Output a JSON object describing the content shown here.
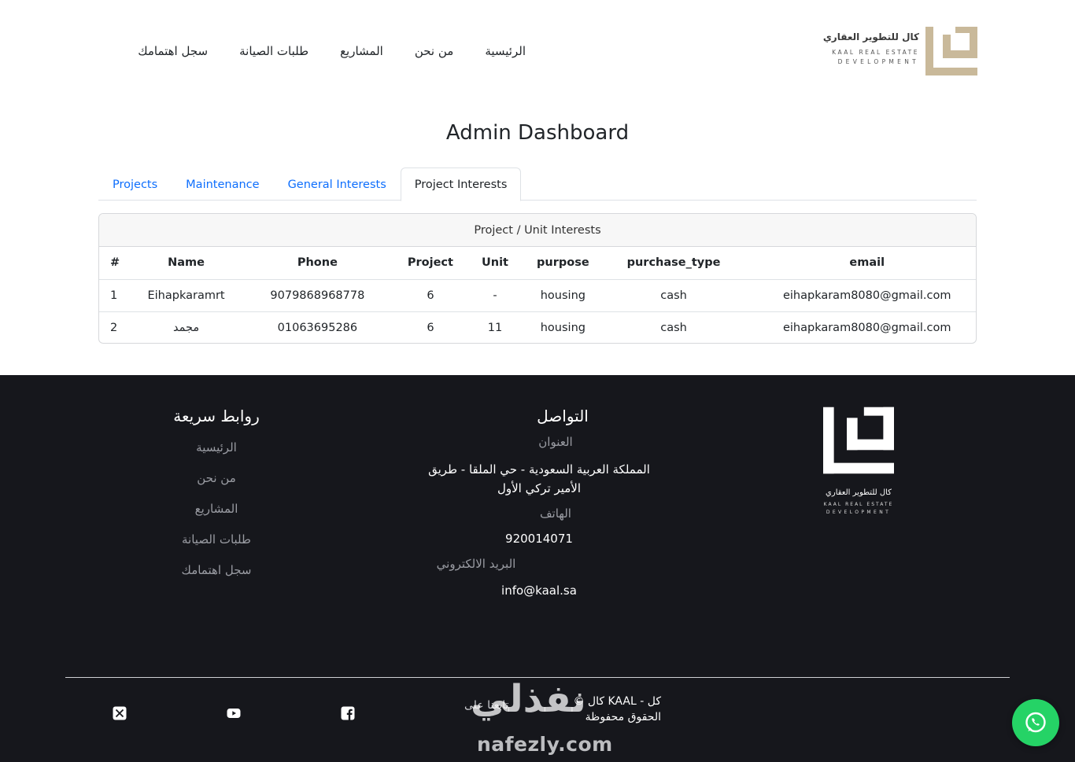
{
  "header": {
    "logo": {
      "arabic": "كال للتطوير العقاري",
      "english_line1": "KAAL REAL ESTATE",
      "english_line2": "DEVELOPMENT",
      "gold_color": "#c9b99a"
    },
    "nav": [
      {
        "label": "الرئيسية"
      },
      {
        "label": "من نحن"
      },
      {
        "label": "المشاريع"
      },
      {
        "label": "طلبات الصيانة"
      },
      {
        "label": "سجل اهتمامك"
      }
    ]
  },
  "page_title": "Admin Dashboard",
  "tabs": [
    {
      "label": "Projects",
      "active": false
    },
    {
      "label": "Maintenance",
      "active": false
    },
    {
      "label": "General Interests",
      "active": false
    },
    {
      "label": "Project Interests",
      "active": true
    }
  ],
  "card": {
    "title": "Project / Unit Interests",
    "columns": [
      "#",
      "Name",
      "Phone",
      "Project",
      "Unit",
      "purpose",
      "purchase_type",
      "email"
    ],
    "rows": [
      [
        "1",
        "Eihapkaramrt",
        "9079868968778",
        "6",
        "-",
        "housing",
        "cash",
        "eihapkaram8080@gmail.com"
      ],
      [
        "2",
        "مجمد",
        "01063695286",
        "6",
        "11",
        "housing",
        "cash",
        "eihapkaram8080@gmail.com"
      ]
    ]
  },
  "footer": {
    "background": "#16171c",
    "quick_links": {
      "title": "روابط سريعة",
      "items": [
        "الرئيسية",
        "من نحن",
        "المشاريع",
        "طلبات الصيانة",
        "سجل اهتمامك"
      ]
    },
    "contact": {
      "title": "التواصل",
      "address_label": "العنوان",
      "address": "المملكة العربية السعودية - حي الملقا - طريق الأمير تركي الأول",
      "phone_label": "الهاتف",
      "phone": "920014071",
      "email_label": "البريد الالكتروني",
      "email": "info@kaal.sa"
    },
    "logo": {
      "arabic": "كال للتطوير العقاري",
      "english_line1": "KAAL REAL ESTATE",
      "english_line2": "DEVELOPMENT"
    },
    "copyright": "© كال KAAL - كل الحقوق محفوظة",
    "follow_us": "تابعنا على",
    "social_icons": [
      "x-icon",
      "youtube-icon",
      "facebook-icon"
    ]
  },
  "watermark": {
    "arabic": "نفذلي",
    "latin": "nafezly.com"
  },
  "whatsapp": {
    "icon": "whatsapp-icon",
    "color": "#25d366"
  }
}
